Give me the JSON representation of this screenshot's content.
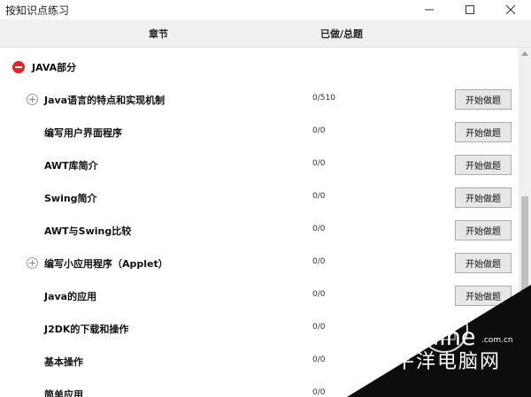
{
  "window": {
    "title": "按知识点练习"
  },
  "header": {
    "chapter": "章节",
    "progress": "已做/总题"
  },
  "section": {
    "label": "JAVA部分"
  },
  "rows": [
    {
      "label": "Java语言的特点和实现机制",
      "progress": "0/510",
      "button": "开始做题",
      "expandable": true
    },
    {
      "label": "编写用户界面程序",
      "progress": "0/0",
      "button": "开始做题",
      "expandable": false
    },
    {
      "label": "AWT库简介",
      "progress": "0/0",
      "button": "开始做题",
      "expandable": false
    },
    {
      "label": "Swing简介",
      "progress": "0/0",
      "button": "开始做题",
      "expandable": false
    },
    {
      "label": "AWT与Swing比较",
      "progress": "0/0",
      "button": "开始做题",
      "expandable": false
    },
    {
      "label": "编写小应用程序（Applet）",
      "progress": "0/0",
      "button": "开始做题",
      "expandable": true
    },
    {
      "label": "Java的应用",
      "progress": "0/0",
      "button": "开始做题",
      "expandable": false
    },
    {
      "label": "J2DK的下载和操作",
      "progress": "0/0",
      "button": "",
      "expandable": false
    },
    {
      "label": "基本操作",
      "progress": "0/0",
      "button": "",
      "expandable": false
    },
    {
      "label": "简单应用",
      "progress": "0/0",
      "button": "",
      "expandable": false
    }
  ],
  "watermark": {
    "brand": "PConline",
    "domain": ".com.cn",
    "cn": "太平洋电脑网"
  }
}
